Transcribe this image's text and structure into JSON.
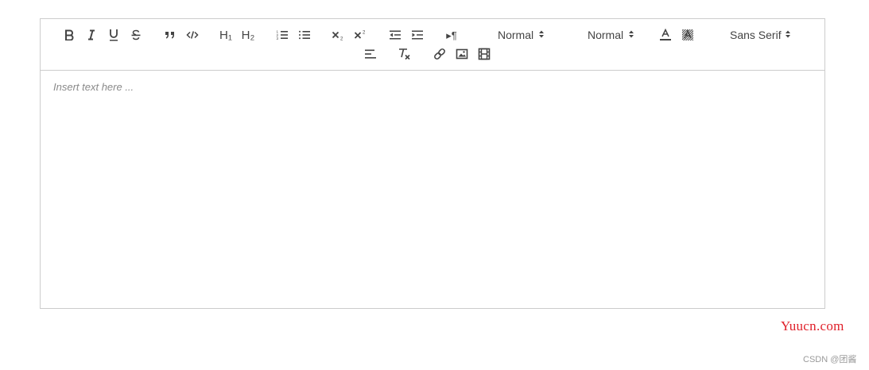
{
  "toolbar": {
    "header_picker": "Normal",
    "size_picker": "Normal",
    "font_picker": "Sans Serif",
    "h1_label": "H₁",
    "h2_label": "H₂",
    "quote_glyph": "”",
    "pilcrow_glyph": "▸¶",
    "icons": [
      "bold-icon",
      "italic-icon",
      "underline-icon",
      "strike-icon",
      "blockquote-icon",
      "code-block-icon",
      "header-1-icon",
      "header-2-icon",
      "ordered-list-icon",
      "bullet-list-icon",
      "subscript-icon",
      "superscript-icon",
      "outdent-icon",
      "indent-icon",
      "direction-icon",
      "text-color-icon",
      "background-color-icon",
      "align-icon",
      "clean-format-icon",
      "link-icon",
      "image-icon",
      "video-icon"
    ]
  },
  "editor": {
    "placeholder": "Insert text here ..."
  },
  "watermark": {
    "site": "Yuucn.com",
    "author": "CSDN @团酱"
  },
  "colors": {
    "border": "#cccccc",
    "icon": "#444444",
    "placeholder": "#8a8a8a",
    "watermark_site": "#e0202a",
    "watermark_author": "#9a9a9a"
  }
}
